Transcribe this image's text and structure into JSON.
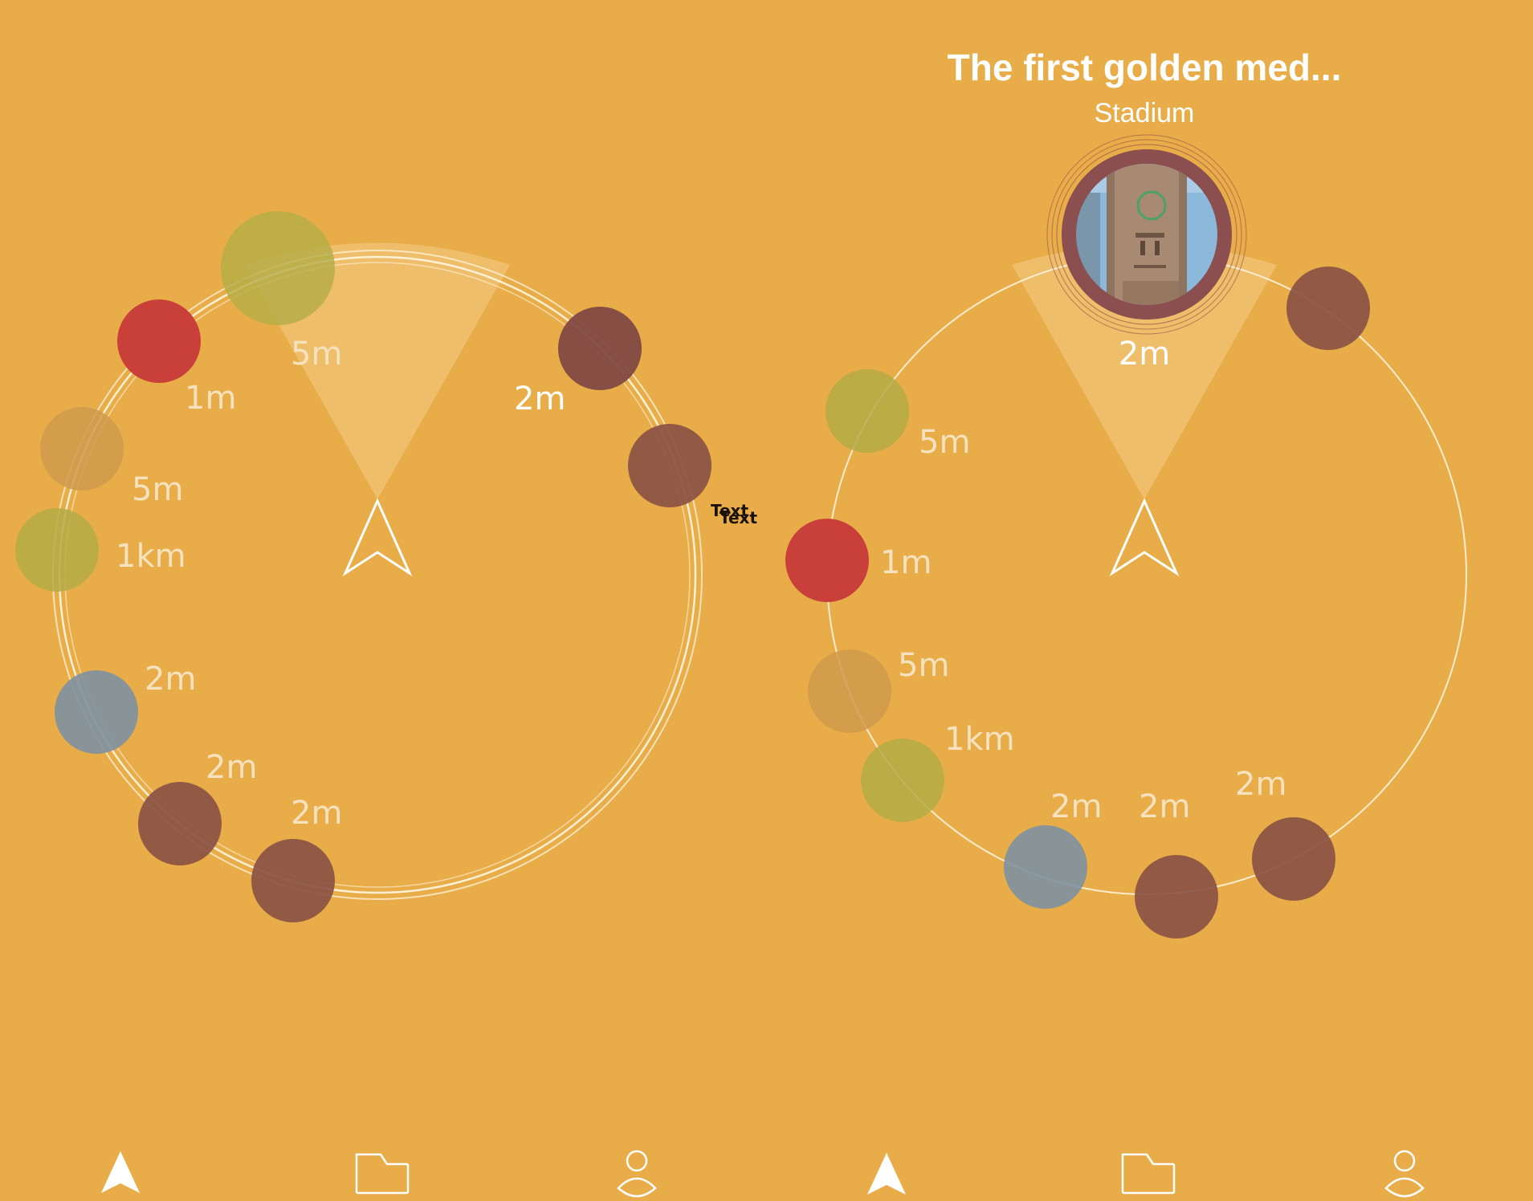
{
  "colors": {
    "background": "#E8AD48",
    "ring": "#FFF3DC",
    "red": "#C9403A",
    "brown": "#8A5344",
    "dark_brown": "#7E4543",
    "olive": "#B4AC46",
    "tan": "#CF9A4E",
    "steel": "#7E91A1",
    "photo_ring": "#8A4F4E"
  },
  "left_radar": {
    "arrow_icon": "navigation-arrow-icon",
    "markers": [
      {
        "label": "5m",
        "color": "olive"
      },
      {
        "label": "1m",
        "color": "red"
      },
      {
        "label": "5m",
        "color": "tan"
      },
      {
        "label": "1km",
        "color": "olive"
      },
      {
        "label": "2m",
        "color": "steel"
      },
      {
        "label": "2m",
        "color": "brown"
      },
      {
        "label": "2m",
        "color": "brown"
      },
      {
        "label": "2m",
        "color": "dark_brown"
      },
      {
        "label": "",
        "color": "brown"
      }
    ],
    "debug_text_1": "Text",
    "debug_text_2": "Text"
  },
  "right_radar": {
    "title": "The first golden med...",
    "subtitle": "Stadium",
    "focused_distance": "2m",
    "arrow_icon": "navigation-arrow-icon",
    "markers": [
      {
        "label": "",
        "color": "brown"
      },
      {
        "label": "5m",
        "color": "olive"
      },
      {
        "label": "1m",
        "color": "red"
      },
      {
        "label": "5m",
        "color": "tan"
      },
      {
        "label": "1km",
        "color": "olive"
      },
      {
        "label": "2m",
        "color": "steel"
      },
      {
        "label": "2m",
        "color": "brown"
      },
      {
        "label": "2m",
        "color": "brown"
      }
    ]
  },
  "bottom_nav": {
    "left": [
      "navigation-arrow-icon",
      "folder-icon",
      "user-icon"
    ],
    "right": [
      "navigation-arrow-icon",
      "folder-icon",
      "user-icon"
    ]
  }
}
